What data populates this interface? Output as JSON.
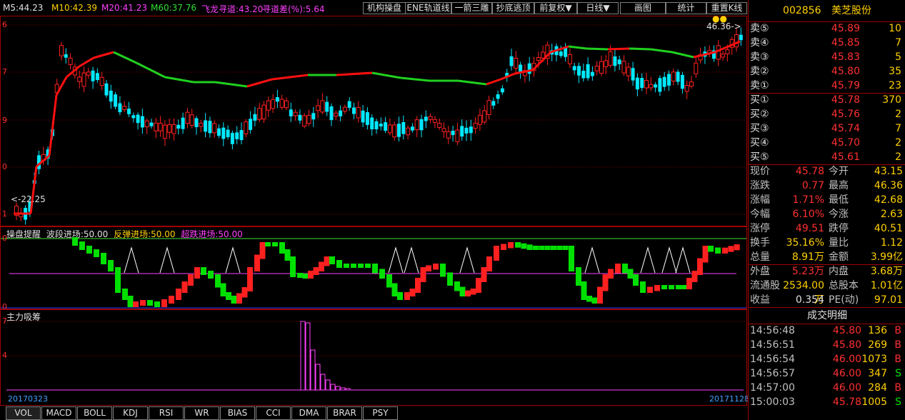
{
  "indicators": {
    "m5": "M5:44.23",
    "m10": "M10:42.39",
    "m20": "M20:41.23",
    "m60": "M60:37.76",
    "flydragon": "飞龙寻道:43.20",
    "daocha": "寻道差(%):5.64"
  },
  "toolbar": [
    "机构操盘",
    "ENE轨道线",
    "一箭三雕",
    "抄底逃顶",
    "前复权▼",
    "日线▼",
    "画图",
    "统计",
    "重置K线"
  ],
  "chart": {
    "low_marker": "<-22.25",
    "high_marker": "46.36->",
    "y_ticks": [
      "6",
      "7",
      "9",
      "0",
      "1"
    ],
    "start_date": "20170323",
    "end_date": "20171128"
  },
  "panel2": {
    "title": "操盘提醒",
    "wave": "波段进场:50.00",
    "rebound": "反弹进场:50.00",
    "oversold": "超跌进场:50.00",
    "y_top": "0",
    "y_bottom": "0"
  },
  "panel3": {
    "title": "主力吸筹",
    "y_top": "7",
    "y_mid": "4"
  },
  "stock": {
    "code": "002856",
    "name": "美芝股份"
  },
  "asks": [
    {
      "label": "卖⑤",
      "price": "45.89",
      "vol": "10"
    },
    {
      "label": "卖④",
      "price": "45.85",
      "vol": "7"
    },
    {
      "label": "卖③",
      "price": "45.83",
      "vol": "5"
    },
    {
      "label": "卖②",
      "price": "45.80",
      "vol": "35"
    },
    {
      "label": "卖①",
      "price": "45.79",
      "vol": "23"
    }
  ],
  "bids": [
    {
      "label": "买①",
      "price": "45.78",
      "vol": "370"
    },
    {
      "label": "买②",
      "price": "45.76",
      "vol": "2"
    },
    {
      "label": "买③",
      "price": "45.74",
      "vol": "7"
    },
    {
      "label": "买④",
      "price": "45.70",
      "vol": "2"
    },
    {
      "label": "买⑤",
      "price": "45.61",
      "vol": "2"
    }
  ],
  "quote": [
    {
      "l1": "现价",
      "v1": "45.78",
      "c1": "red",
      "l2": "今开",
      "v2": "43.15",
      "c2": "green"
    },
    {
      "l1": "涨跌",
      "v1": "0.77",
      "c1": "red",
      "l2": "最高",
      "v2": "46.36",
      "c2": "red"
    },
    {
      "l1": "涨幅",
      "v1": "1.71%",
      "c1": "red",
      "l2": "最低",
      "v2": "42.68",
      "c2": "green"
    },
    {
      "l1": "今幅",
      "v1": "6.10%",
      "c1": "red",
      "l2": "今涨",
      "v2": "2.63",
      "c2": "red"
    },
    {
      "l1": "涨停",
      "v1": "49.51",
      "c1": "red",
      "l2": "跌停",
      "v2": "40.51",
      "c2": "green"
    },
    {
      "l1": "换手",
      "v1": "35.16%",
      "c1": "yel",
      "l2": "量比",
      "v2": "1.12",
      "c2": "red"
    },
    {
      "l1": "总量",
      "v1": "8.91万",
      "c1": "yel",
      "l2": "金额",
      "v2": "3.99亿",
      "c2": "yel"
    },
    {
      "l1": "外盘",
      "v1": "5.23万",
      "c1": "red",
      "l2": "内盘",
      "v2": "3.68万",
      "c2": "green"
    },
    {
      "l1": "流通股",
      "v1": "2534.00万",
      "c1": "yel",
      "l2": "总股本",
      "v2": "1.01亿",
      "c2": "yel"
    },
    {
      "l1": "收益",
      "v1": "0.354",
      "c1": "white",
      "l2": "PE(动)",
      "v2": "97.01",
      "c2": "yel"
    }
  ],
  "trades_title": "成交明细",
  "trades": [
    {
      "time": "14:56:48",
      "price": "45.80",
      "vol": "136",
      "side": "B"
    },
    {
      "time": "14:56:51",
      "price": "45.80",
      "vol": "269",
      "side": "B"
    },
    {
      "time": "14:56:54",
      "price": "46.00",
      "vol": "1073",
      "side": "B"
    },
    {
      "time": "14:56:57",
      "price": "46.00",
      "vol": "347",
      "side": "S"
    },
    {
      "time": "14:57:00",
      "price": "46.00",
      "vol": "284",
      "side": "B"
    },
    {
      "time": "15:00:03",
      "price": "45.78",
      "vol": "1005",
      "side": "S"
    }
  ],
  "tabs": [
    "VOL",
    "MACD",
    "BOLL",
    "KDJ",
    "RSI",
    "WR",
    "BIAS",
    "CCI",
    "DMA",
    "BRAR",
    "PSY"
  ],
  "colors": {
    "up": "#ff2020",
    "down": "#00e8ff",
    "ma_up": "#ff1010",
    "ma_down": "#20d020"
  }
}
